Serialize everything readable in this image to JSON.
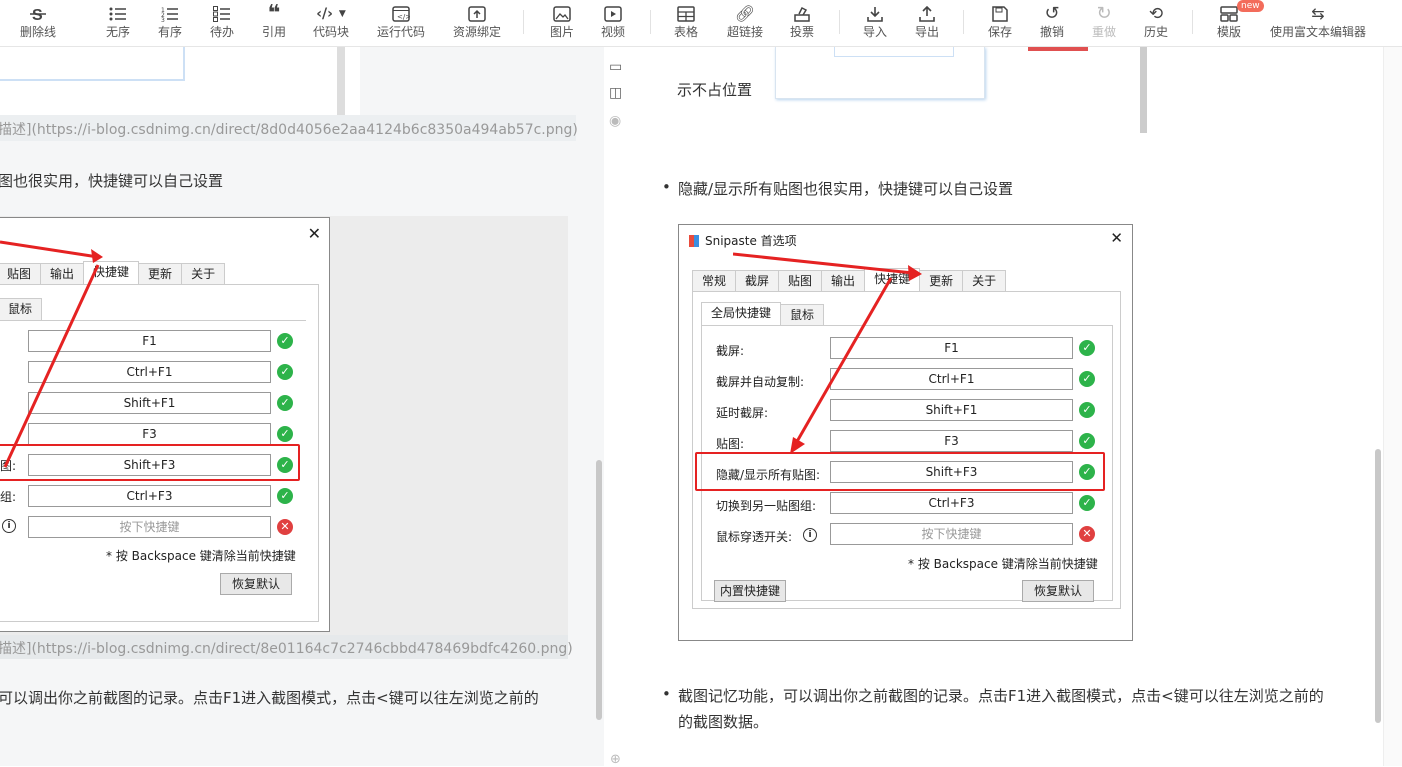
{
  "toolbar": {
    "items": [
      {
        "label": "删除线",
        "icon": "strikethrough-icon"
      },
      {
        "label": "无序",
        "icon": "unordered-list-icon"
      },
      {
        "label": "有序",
        "icon": "ordered-list-icon"
      },
      {
        "label": "待办",
        "icon": "todo-list-icon"
      },
      {
        "label": "引用",
        "icon": "quote-icon"
      },
      {
        "label": "代码块",
        "icon": "code-block-icon"
      },
      {
        "label": "运行代码",
        "icon": "run-code-icon"
      },
      {
        "label": "资源绑定",
        "icon": "resource-bind-icon"
      },
      {
        "label": "图片",
        "icon": "image-icon"
      },
      {
        "label": "视频",
        "icon": "video-icon"
      },
      {
        "label": "表格",
        "icon": "table-icon"
      },
      {
        "label": "超链接",
        "icon": "link-icon"
      },
      {
        "label": "投票",
        "icon": "vote-icon"
      },
      {
        "label": "导入",
        "icon": "import-icon"
      },
      {
        "label": "导出",
        "icon": "export-icon"
      },
      {
        "label": "保存",
        "icon": "save-icon"
      },
      {
        "label": "撤销",
        "icon": "undo-icon"
      },
      {
        "label": "重做",
        "icon": "redo-icon"
      },
      {
        "label": "历史",
        "icon": "history-icon"
      },
      {
        "label": "模版",
        "icon": "template-icon"
      },
      {
        "label": "使用富文本编辑器",
        "icon": "switch-editor-icon"
      }
    ],
    "new_badge": "new"
  },
  "left": {
    "link1": "描述](https://i-blog.csdnimg.cn/direct/8d0d4056e2aa4124b6c8350a494ab57c.png)",
    "text1": "图也很实用，快捷键可以自己设置",
    "link2": "描述](https://i-blog.csdnimg.cn/direct/8e01164c7c2746cbbd478469bdfc4260.png)",
    "text2": "可以调出你之前截图的记录。点击F1进入截图模式，点击<键可以往左浏览之前的",
    "dialog": {
      "tabs": [
        "贴图",
        "输出",
        "快捷键",
        "更新",
        "关于"
      ],
      "subtab": "鼠标",
      "labels": [
        "图:",
        "组:"
      ],
      "keys": [
        "F1",
        "Ctrl+F1",
        "Shift+F1",
        "F3",
        "Shift+F3",
        "Ctrl+F3",
        "按下快捷键"
      ],
      "note": "* 按 Backspace 键清除当前快捷键",
      "restore": "恢复默认"
    }
  },
  "right": {
    "top_text": "示不占位置",
    "bullet1": "隐藏/显示所有贴图也很实用，快捷键可以自己设置",
    "bullet2_line1": "截图记忆功能，可以调出你之前截图的记录。点击F1进入截图模式，点击<键可以往左浏览之前的",
    "bullet2_line2": "的截图数据。",
    "dialog": {
      "title": "Snipaste 首选项",
      "tabs": [
        "常规",
        "截屏",
        "贴图",
        "输出",
        "快捷键",
        "更新",
        "关于"
      ],
      "subtabs": [
        "全局快捷键",
        "鼠标"
      ],
      "rows": [
        {
          "label": "截屏:",
          "key": "F1",
          "status": "ok"
        },
        {
          "label": "截屏并自动复制:",
          "key": "Ctrl+F1",
          "status": "ok"
        },
        {
          "label": "延时截屏:",
          "key": "Shift+F1",
          "status": "ok"
        },
        {
          "label": "贴图:",
          "key": "F3",
          "status": "ok"
        },
        {
          "label": "隐藏/显示所有贴图:",
          "key": "Shift+F3",
          "status": "ok"
        },
        {
          "label": "切换到另一贴图组:",
          "key": "Ctrl+F3",
          "status": "ok"
        },
        {
          "label": "鼠标穿透开关:",
          "key": "按下快捷键",
          "status": "error"
        }
      ],
      "note": "* 按 Backspace 键清除当前快捷键",
      "builtin": "内置快捷键",
      "restore": "恢复默认"
    }
  },
  "colors": {
    "accent_red": "#e52222",
    "ok_green": "#2db34a",
    "error_red": "#e04040"
  }
}
